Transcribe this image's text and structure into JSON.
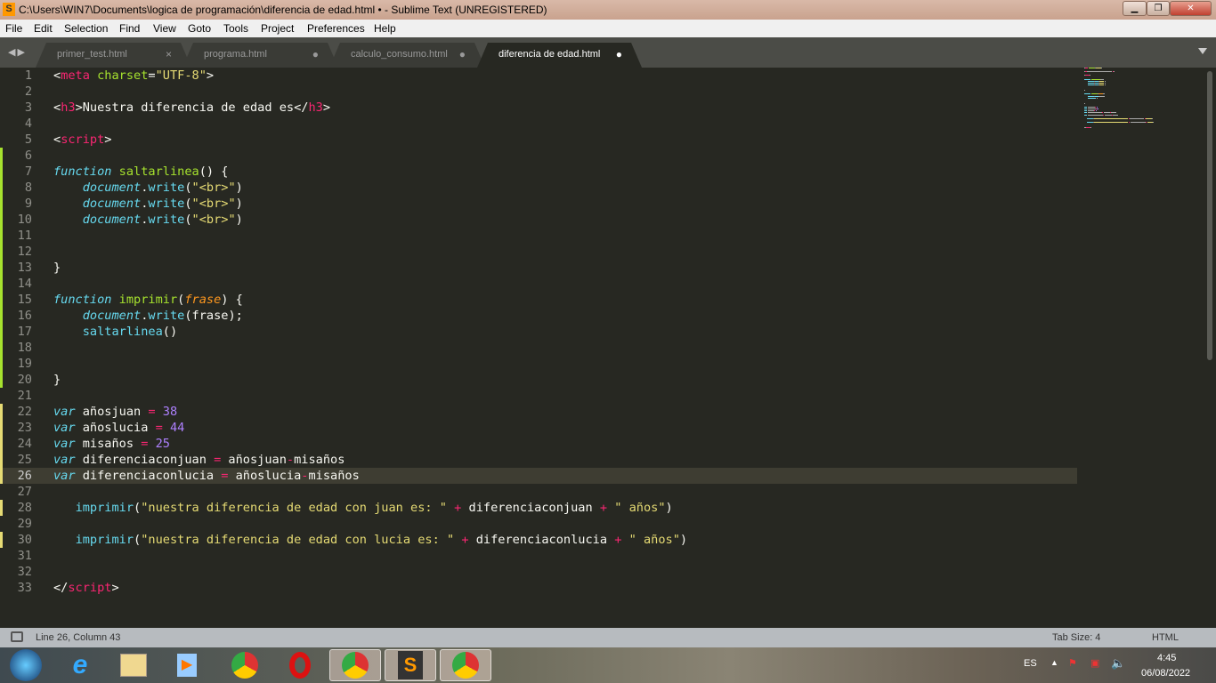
{
  "window": {
    "title": "C:\\Users\\WIN7\\Documents\\logica de programación\\diferencia de edad.html • - Sublime Text (UNREGISTERED)",
    "minimize": "▁",
    "maximize": "❐",
    "close": "✕"
  },
  "menu": [
    "File",
    "Edit",
    "Selection",
    "Find",
    "View",
    "Goto",
    "Tools",
    "Project",
    "Preferences",
    "Help"
  ],
  "tabs": [
    {
      "label": "primer_test.html",
      "close": "×",
      "active": false
    },
    {
      "label": "programa.html",
      "close": "●",
      "active": false
    },
    {
      "label": "calculo_consumo.html",
      "close": "●",
      "active": false
    },
    {
      "label": "diferencia de edad.html",
      "close": "●",
      "active": true
    }
  ],
  "editor": {
    "current_line": 26,
    "modified_lines_green": [
      6,
      7,
      8,
      9,
      10,
      11,
      12,
      13,
      14,
      15,
      16,
      17,
      18,
      19,
      20
    ],
    "modified_lines_yellow": [
      22,
      23,
      24,
      25,
      26,
      28,
      30
    ],
    "colors": {
      "background": "#272822",
      "keyword": "#66d9ef",
      "function": "#a6e22e",
      "string": "#e6db74",
      "operator": "#f92672",
      "number": "#ae81ff",
      "param": "#fd971f"
    },
    "lines": [
      [
        [
          "p",
          "<"
        ],
        [
          "t",
          "meta"
        ],
        [
          "p",
          " "
        ],
        [
          "n",
          "charset"
        ],
        [
          "p",
          "="
        ],
        [
          "s",
          "\"UTF-8\""
        ],
        [
          "p",
          ">"
        ]
      ],
      [],
      [
        [
          "p",
          "<"
        ],
        [
          "t",
          "h3"
        ],
        [
          "p",
          ">Nuestra diferencia de edad es</"
        ],
        [
          "t",
          "h3"
        ],
        [
          "p",
          ">"
        ]
      ],
      [],
      [
        [
          "p",
          "<"
        ],
        [
          "t",
          "script"
        ],
        [
          "p",
          ">"
        ]
      ],
      [],
      [
        [
          "k",
          "function"
        ],
        [
          "p",
          " "
        ],
        [
          "n",
          "saltarlinea"
        ],
        [
          "p",
          "() {"
        ]
      ],
      [
        [
          "p",
          "    "
        ],
        [
          "k",
          "document"
        ],
        [
          "p",
          "."
        ],
        [
          "c",
          "write"
        ],
        [
          "p",
          "("
        ],
        [
          "s",
          "\"<br>\""
        ],
        [
          "p",
          ")"
        ]
      ],
      [
        [
          "p",
          "    "
        ],
        [
          "k",
          "document"
        ],
        [
          "p",
          "."
        ],
        [
          "c",
          "write"
        ],
        [
          "p",
          "("
        ],
        [
          "s",
          "\"<br>\""
        ],
        [
          "p",
          ")"
        ]
      ],
      [
        [
          "p",
          "    "
        ],
        [
          "k",
          "document"
        ],
        [
          "p",
          "."
        ],
        [
          "c",
          "write"
        ],
        [
          "p",
          "("
        ],
        [
          "s",
          "\"<br>\""
        ],
        [
          "p",
          ")"
        ]
      ],
      [],
      [],
      [
        [
          "p",
          "}"
        ]
      ],
      [],
      [
        [
          "k",
          "function"
        ],
        [
          "p",
          " "
        ],
        [
          "n",
          "imprimir"
        ],
        [
          "p",
          "("
        ],
        [
          "a",
          "frase"
        ],
        [
          "p",
          ") {"
        ]
      ],
      [
        [
          "p",
          "    "
        ],
        [
          "k",
          "document"
        ],
        [
          "p",
          "."
        ],
        [
          "c",
          "write"
        ],
        [
          "p",
          "(frase);"
        ]
      ],
      [
        [
          "p",
          "    "
        ],
        [
          "c",
          "saltarlinea"
        ],
        [
          "p",
          "()"
        ]
      ],
      [],
      [],
      [
        [
          "p",
          "}"
        ]
      ],
      [],
      [
        [
          "k",
          "var"
        ],
        [
          "p",
          " añosjuan "
        ],
        [
          "o",
          "="
        ],
        [
          "p",
          " "
        ],
        [
          "m",
          "38"
        ]
      ],
      [
        [
          "k",
          "var"
        ],
        [
          "p",
          " añoslucia "
        ],
        [
          "o",
          "="
        ],
        [
          "p",
          " "
        ],
        [
          "m",
          "44"
        ]
      ],
      [
        [
          "k",
          "var"
        ],
        [
          "p",
          " misaños "
        ],
        [
          "o",
          "="
        ],
        [
          "p",
          " "
        ],
        [
          "m",
          "25"
        ]
      ],
      [
        [
          "k",
          "var"
        ],
        [
          "p",
          " diferenciaconjuan "
        ],
        [
          "o",
          "="
        ],
        [
          "p",
          " añosjuan"
        ],
        [
          "o",
          "-"
        ],
        [
          "p",
          "misaños"
        ]
      ],
      [
        [
          "k",
          "var"
        ],
        [
          "p",
          " diferenciaconlucia "
        ],
        [
          "o",
          "="
        ],
        [
          "p",
          " añoslucia"
        ],
        [
          "o",
          "-"
        ],
        [
          "p",
          "misaños"
        ]
      ],
      [],
      [
        [
          "p",
          "   "
        ],
        [
          "c",
          "imprimir"
        ],
        [
          "p",
          "("
        ],
        [
          "s",
          "\"nuestra diferencia de edad con juan es: \""
        ],
        [
          "p",
          " "
        ],
        [
          "o",
          "+"
        ],
        [
          "p",
          " diferenciaconjuan "
        ],
        [
          "o",
          "+"
        ],
        [
          "p",
          " "
        ],
        [
          "s",
          "\" años\""
        ],
        [
          "p",
          ")"
        ]
      ],
      [],
      [
        [
          "p",
          "   "
        ],
        [
          "c",
          "imprimir"
        ],
        [
          "p",
          "("
        ],
        [
          "s",
          "\"nuestra diferencia de edad con lucia es: \""
        ],
        [
          "p",
          " "
        ],
        [
          "o",
          "+"
        ],
        [
          "p",
          " diferenciaconlucia "
        ],
        [
          "o",
          "+"
        ],
        [
          "p",
          " "
        ],
        [
          "s",
          "\" años\""
        ],
        [
          "p",
          ")"
        ]
      ],
      [],
      [],
      [
        [
          "p",
          "</"
        ],
        [
          "t",
          "script"
        ],
        [
          "p",
          ">"
        ]
      ]
    ]
  },
  "status": {
    "position": "Line 26, Column 43",
    "tab_size": "Tab Size: 4",
    "syntax": "HTML"
  },
  "taskbar": {
    "apps": [
      {
        "icon": "windows-start-icon",
        "open": false
      },
      {
        "icon": "internet-explorer-icon",
        "open": false
      },
      {
        "icon": "file-explorer-icon",
        "open": false
      },
      {
        "icon": "media-player-icon",
        "open": false
      },
      {
        "icon": "chrome-icon",
        "open": false
      },
      {
        "icon": "opera-icon",
        "open": false
      },
      {
        "icon": "chrome-profile-icon",
        "open": true
      },
      {
        "icon": "sublime-text-icon",
        "open": true
      },
      {
        "icon": "chrome-profile-icon",
        "open": true
      }
    ],
    "language": "ES",
    "time": "4:45",
    "date": "06/08/2022"
  }
}
